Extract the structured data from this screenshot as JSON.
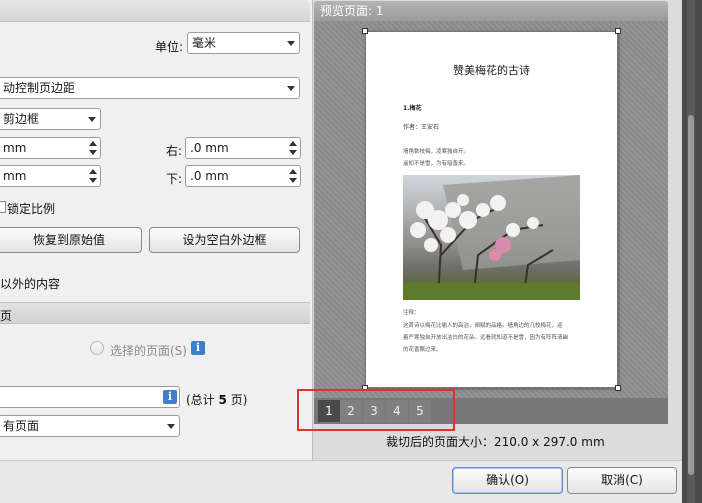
{
  "settings": {
    "unit_label": "单位:",
    "unit_value": "毫米",
    "margin_mode_value": "动控制页边距",
    "crop_box_value": "剪边框",
    "left_value": "mm",
    "right_label": "右:",
    "right_value": ".0 mm",
    "top_value": "mm",
    "bottom_label": "下:",
    "bottom_value": ".0 mm",
    "lock_ratio_label": "锁定比例",
    "restore_button": "恢复到原始值",
    "blank_margin_button": "设为空白外边框",
    "outside_content_label": "以外的内容"
  },
  "pages_section": {
    "header_label": "页",
    "selected_pages_label": "选择的页面(S)",
    "info_glyph": "i",
    "page_range_value": "",
    "total_prefix": "(总计",
    "total_count": "5",
    "total_suffix": "页)",
    "apply_to_value": "有页面"
  },
  "preview": {
    "header": "预览页面: 1",
    "doc_title": "赞美梅花的古诗",
    "doc_heading": "1.梅花",
    "doc_author": "作者：王安石",
    "poem_line1": "墙角数枝梅，凌寒独自开。",
    "poem_line2": "遥知不是雪，为有暗香来。",
    "note_label": "注释：",
    "note_line1": "这首诗以梅花比喻人的高洁，阐赋的品格。墙角边的几枝梅花，迎",
    "note_line2": "着严寒独自开放出洁白的花朵。远看就知道不是雪，因为有阵阵清幽",
    "note_line3": "的花香飘过来。",
    "pages": [
      "1",
      "2",
      "3",
      "4",
      "5"
    ],
    "active_page": "1",
    "size_label": "裁切后的页面大小：210.0 x 297.0 mm"
  },
  "footer": {
    "ok_button": "确认(O)",
    "cancel_button": "取消(C)"
  },
  "icons": {
    "info": "info-icon",
    "combo": "chevron-down-icon",
    "spin": "spinner-icon"
  },
  "colors": {
    "highlight": "#e03232",
    "accent": "#3f7ec9"
  }
}
